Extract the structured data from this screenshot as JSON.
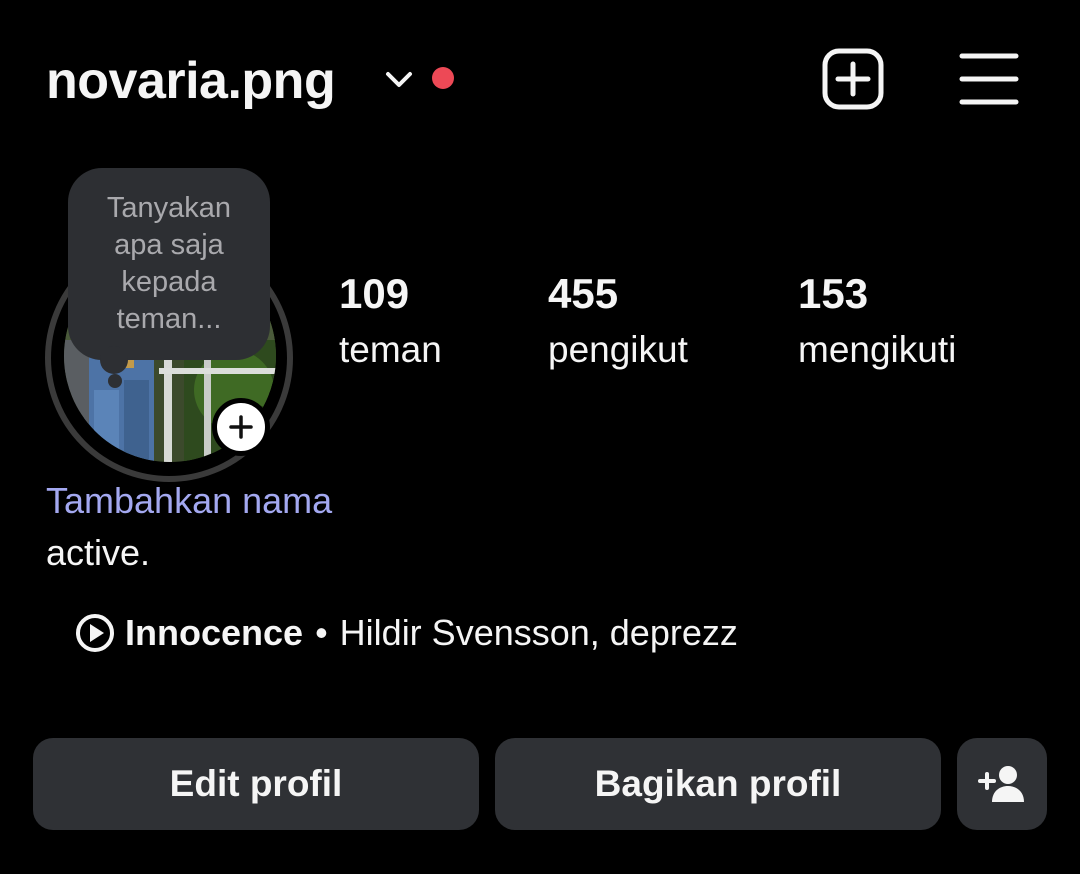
{
  "header": {
    "username": "novaria.png",
    "account_switch_icon": "chevron-down-icon",
    "notification_dot_color": "#ed4956",
    "new_post_icon": "plus-square-icon",
    "menu_icon": "hamburger-menu-icon"
  },
  "note": {
    "placeholder": "Tanyakan apa saja kepada teman..."
  },
  "avatar": {
    "add_story_icon": "plus-icon"
  },
  "stats": {
    "friends": {
      "count": "109",
      "label": "teman"
    },
    "followers": {
      "count": "455",
      "label": "pengikut"
    },
    "following": {
      "count": "153",
      "label": "mengikuti"
    }
  },
  "profile": {
    "add_name": "Tambahkan nama",
    "add_name_color": "#a3a8f0",
    "bio": "active."
  },
  "music": {
    "icon": "play-circle-icon",
    "title": "Innocence",
    "separator": "•",
    "artists": "Hildir Svensson, deprezz"
  },
  "actions": {
    "edit_profile": "Edit profil",
    "share_profile": "Bagikan profil",
    "add_friend_icon": "add-person-icon"
  }
}
